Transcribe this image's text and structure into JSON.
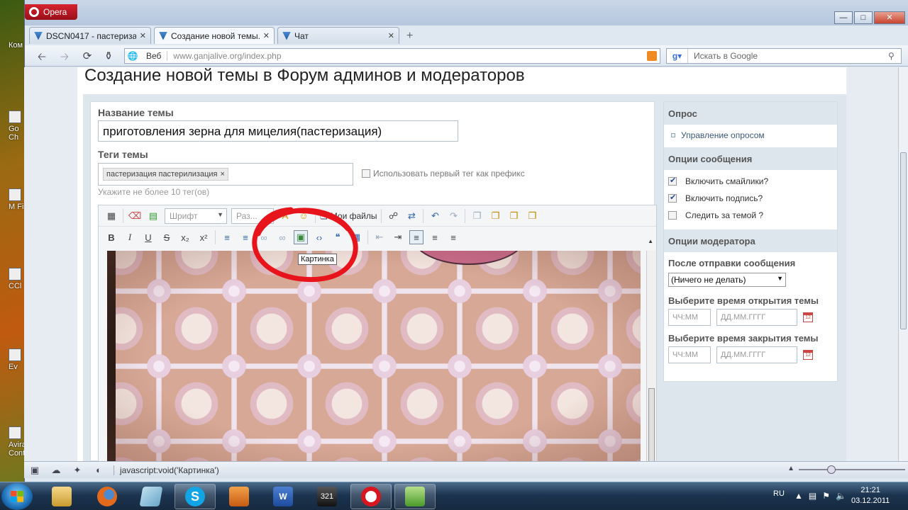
{
  "browser": {
    "menu_label": "Opera",
    "tabs": [
      {
        "label": "DSCN0417 - пастериза..."
      },
      {
        "label": "Создание новой темы..."
      },
      {
        "label": "Чат"
      }
    ],
    "address_mode": "Веб",
    "url": "www.ganjalive.org/index.php",
    "search_placeholder": "Искать в Google",
    "status_text": "javascript:void('Картинка')"
  },
  "page": {
    "title": "Создание новой темы в Форум админов и модераторов",
    "topic_label": "Название темы",
    "topic_value": "приготовления зерна для мицелия(пастеризация)",
    "tags_label": "Теги темы",
    "tag_chip": "пастеризация пастерилизация",
    "tag_remove": "×",
    "prefix_checkbox_label": "Использовать первый тег как префикс",
    "tags_hint": "Укажите не более 10 тег(ов)"
  },
  "editor": {
    "font_select": "Шрифт",
    "size_select": "Раз...",
    "my_files": "Мои файлы",
    "tooltip": "Картинка",
    "format_buttons": [
      "B",
      "I",
      "U",
      "S"
    ]
  },
  "sidebar": {
    "poll_header": "Опрос",
    "poll_link": "Управление опросом",
    "msg_options_header": "Опции сообщения",
    "options": [
      {
        "label": "Включить смайлики?",
        "checked": true
      },
      {
        "label": "Включить подпись?",
        "checked": true
      },
      {
        "label": "Следить за темой ?",
        "checked": false
      }
    ],
    "mod_options_header": "Опции модератора",
    "after_post_label": "После отправки сообщения",
    "after_post_value": "(Ничего не делать)",
    "open_time_label": "Выберите время открытия темы",
    "close_time_label": "Выберите время закрытия темы",
    "time_placeholder": "ЧЧ:ММ",
    "date_placeholder": "ДД.ММ.ГГГГ",
    "calendar_day": "12"
  },
  "desktop_icons": [
    "Ком",
    "Go Ch",
    "M Fi",
    "CCl",
    "Ev",
    "Avira Cont"
  ],
  "taskbar": {
    "language": "RU",
    "time": "21:21",
    "date": "03.12.2011",
    "apps": [
      "explorer",
      "firefox",
      "unknown-app",
      "skype",
      "media-player",
      "word",
      "media-player-classic",
      "opera",
      "misc"
    ]
  }
}
